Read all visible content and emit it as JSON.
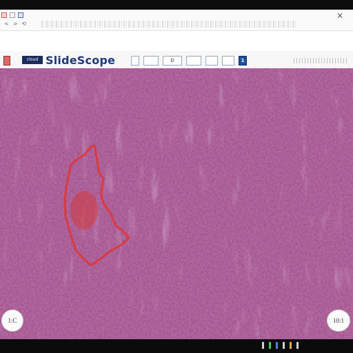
{
  "app": {
    "name": "SlideScope"
  },
  "topbar": {
    "left_buttons": [
      "<",
      ">",
      "⟲"
    ],
    "close_glyph": "✕"
  },
  "toolbar": {
    "logo_text": "cloud",
    "buttons": [
      "",
      "",
      "D",
      "",
      "",
      "",
      "1"
    ]
  },
  "viewport": {
    "annotation_color": "#e03535",
    "tissue_base_color": "#b56aa0"
  },
  "zoom": {
    "left_label": "1:C",
    "right_label": "10:1"
  },
  "taskbar": {
    "clock": ""
  }
}
